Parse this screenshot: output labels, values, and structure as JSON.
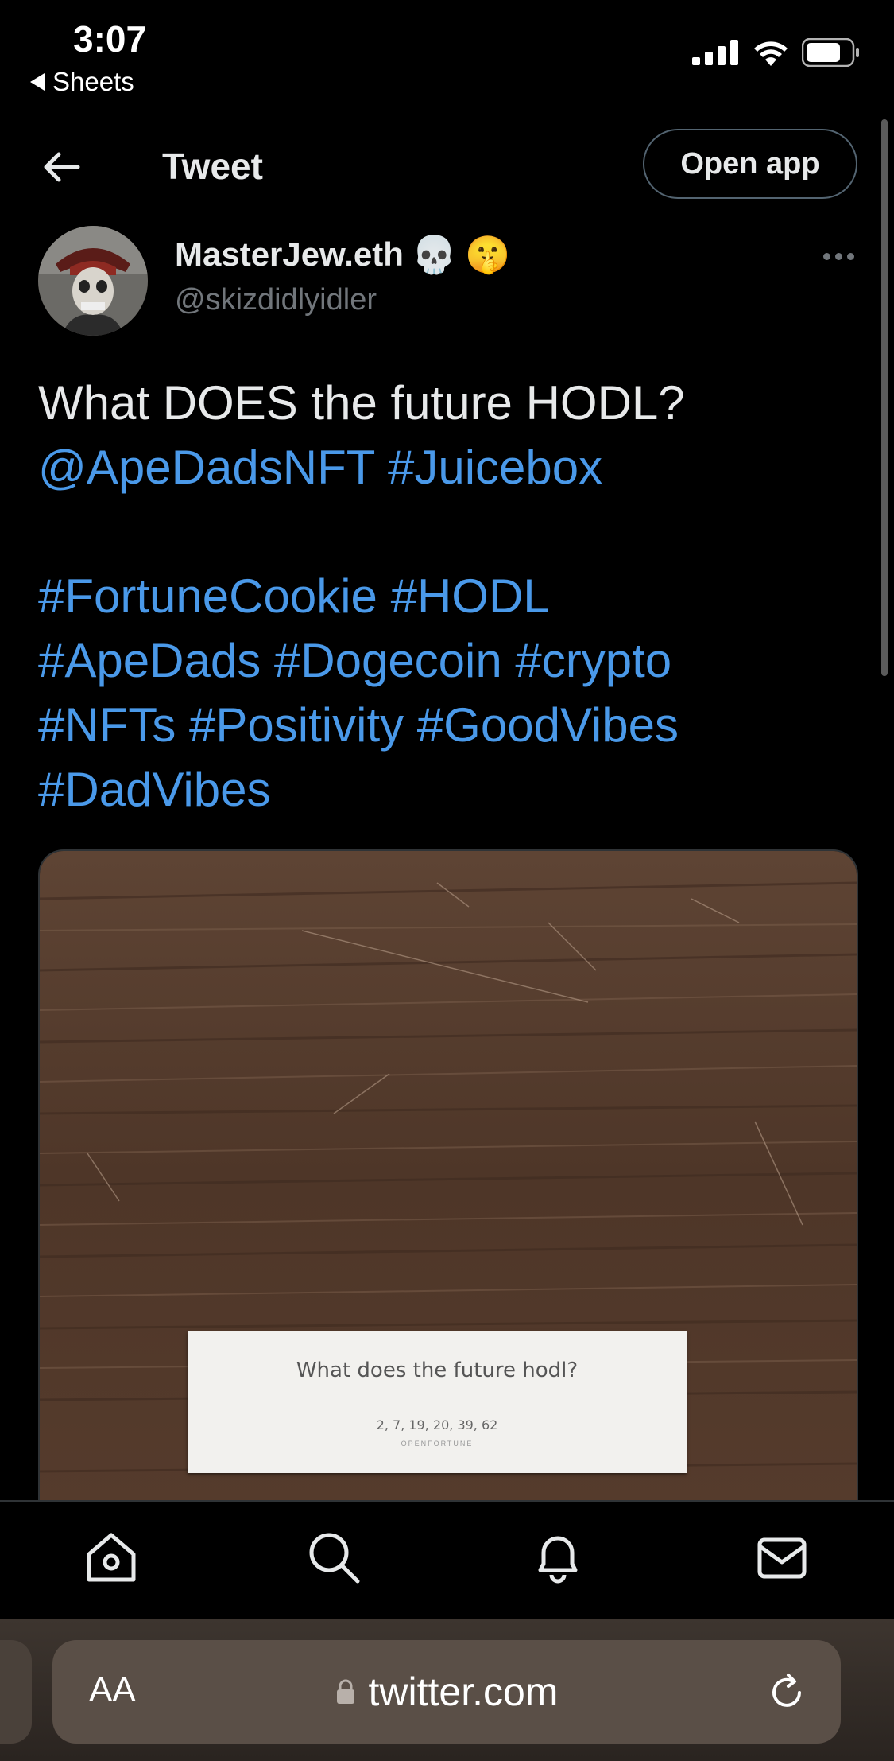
{
  "status_bar": {
    "time": "3:07",
    "back_app": "Sheets"
  },
  "header": {
    "title": "Tweet",
    "open_app_label": "Open app"
  },
  "author": {
    "name": "MasterJew.eth",
    "emojis": [
      "💀",
      "🤫"
    ],
    "handle": "@skizdidlyidler"
  },
  "tweet": {
    "line1": "What DOES the future HODL?",
    "mention": "@ApeDadsNFT",
    "hashtags_line1": [
      "#Juicebox"
    ],
    "hashtags": [
      [
        "#FortuneCookie",
        "#HODL"
      ],
      [
        "#ApeDads",
        "#Dogecoin",
        "#crypto"
      ],
      [
        "#NFTs",
        "#Positivity",
        "#GoodVibes"
      ],
      [
        "#DadVibes"
      ]
    ]
  },
  "media": {
    "fortune_text": "What does the future hodl?",
    "lucky_numbers": "2, 7, 19, 20, 39, 62",
    "brand": "OPENFORTUNE"
  },
  "nav": {
    "icons": [
      "home-icon",
      "search-icon",
      "notifications-icon",
      "messages-icon"
    ]
  },
  "browser": {
    "aa_label": "AA",
    "url": "twitter.com"
  },
  "colors": {
    "link": "#4a99e9",
    "text": "#e7e9ea",
    "muted": "#71767b",
    "background": "#000000"
  }
}
